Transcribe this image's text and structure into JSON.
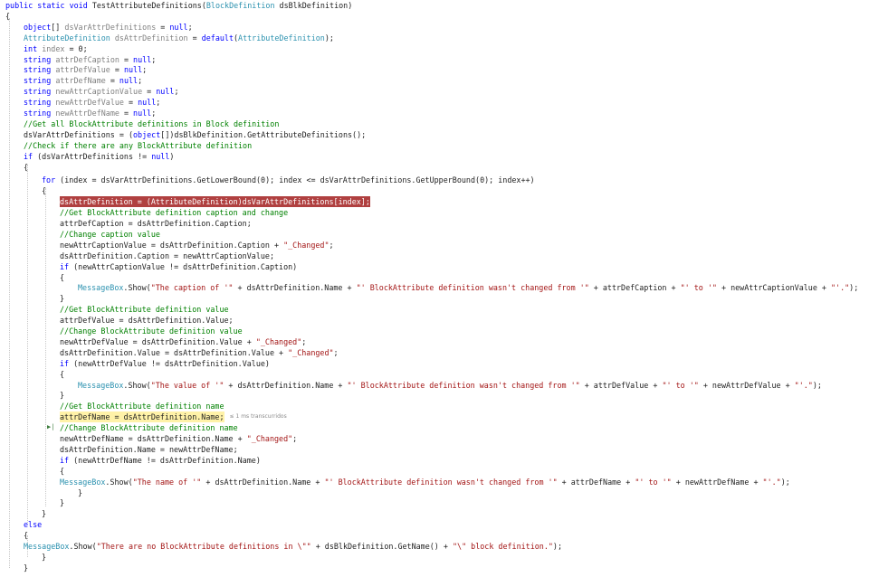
{
  "code": {
    "lines": [
      [
        {
          "t": "public static void ",
          "c": "kw"
        },
        {
          "t": "TestAttributeDefinitions(",
          "c": ""
        },
        {
          "t": "BlockDefinition",
          "c": "ty"
        },
        {
          "t": " dsBlkDefinition)",
          "c": ""
        }
      ],
      [
        {
          "t": "{",
          "c": ""
        }
      ],
      [
        {
          "t": "object",
          "c": "kw"
        },
        {
          "t": "[] ",
          "c": ""
        },
        {
          "t": "dsVarAttrDefinitions",
          "c": "dim"
        },
        {
          "t": " = ",
          "c": ""
        },
        {
          "t": "null",
          "c": "kw"
        },
        {
          "t": ";",
          "c": ""
        }
      ],
      [
        {
          "t": "AttributeDefinition",
          "c": "ty"
        },
        {
          "t": " ",
          "c": ""
        },
        {
          "t": "dsAttrDefinition",
          "c": "dim"
        },
        {
          "t": " = ",
          "c": ""
        },
        {
          "t": "default",
          "c": "kw"
        },
        {
          "t": "(",
          "c": ""
        },
        {
          "t": "AttributeDefinition",
          "c": "ty"
        },
        {
          "t": ");",
          "c": ""
        }
      ],
      [
        {
          "t": "int",
          "c": "kw"
        },
        {
          "t": " ",
          "c": ""
        },
        {
          "t": "index",
          "c": "dim"
        },
        {
          "t": " = 0;",
          "c": ""
        }
      ],
      [
        {
          "t": "string",
          "c": "kw"
        },
        {
          "t": " ",
          "c": ""
        },
        {
          "t": "attrDefCaption",
          "c": "dim"
        },
        {
          "t": " = ",
          "c": ""
        },
        {
          "t": "null",
          "c": "kw"
        },
        {
          "t": ";",
          "c": ""
        }
      ],
      [
        {
          "t": "string",
          "c": "kw"
        },
        {
          "t": " ",
          "c": ""
        },
        {
          "t": "attrDefValue",
          "c": "dim"
        },
        {
          "t": " = ",
          "c": ""
        },
        {
          "t": "null",
          "c": "kw"
        },
        {
          "t": ";",
          "c": ""
        }
      ],
      [
        {
          "t": "string",
          "c": "kw"
        },
        {
          "t": " ",
          "c": ""
        },
        {
          "t": "attrDefName",
          "c": "dim"
        },
        {
          "t": " = ",
          "c": ""
        },
        {
          "t": "null",
          "c": "kw"
        },
        {
          "t": ";",
          "c": ""
        }
      ],
      [
        {
          "t": "string",
          "c": "kw"
        },
        {
          "t": " ",
          "c": ""
        },
        {
          "t": "newAttrCaptionValue",
          "c": "dim"
        },
        {
          "t": " = ",
          "c": ""
        },
        {
          "t": "null",
          "c": "kw"
        },
        {
          "t": ";",
          "c": ""
        }
      ],
      [
        {
          "t": "string",
          "c": "kw"
        },
        {
          "t": " ",
          "c": ""
        },
        {
          "t": "newAttrDefValue",
          "c": "dim"
        },
        {
          "t": " = ",
          "c": ""
        },
        {
          "t": "null",
          "c": "kw"
        },
        {
          "t": ";",
          "c": ""
        }
      ],
      [
        {
          "t": "string",
          "c": "kw"
        },
        {
          "t": " ",
          "c": ""
        },
        {
          "t": "newAttrDefName",
          "c": "dim"
        },
        {
          "t": " = ",
          "c": ""
        },
        {
          "t": "null",
          "c": "kw"
        },
        {
          "t": ";",
          "c": ""
        }
      ],
      [
        {
          "t": "//Get all BlockAttribute definitions in Block definition",
          "c": "cm"
        }
      ],
      [
        {
          "t": "dsVarAttrDefinitions = (",
          "c": ""
        },
        {
          "t": "object",
          "c": "kw"
        },
        {
          "t": "[])dsBlkDefinition.GetAttributeDefinitions();",
          "c": ""
        }
      ],
      [
        {
          "t": "//Check if there are any BlockAttribute definition",
          "c": "cm"
        }
      ],
      [
        {
          "t": "if",
          "c": "kw"
        },
        {
          "t": " (dsVarAttrDefinitions != ",
          "c": ""
        },
        {
          "t": "null",
          "c": "kw"
        },
        {
          "t": ")",
          "c": ""
        }
      ],
      [
        {
          "t": "{",
          "c": ""
        }
      ],
      [
        {
          "t": "for",
          "c": "kw"
        },
        {
          "t": " (index = dsVarAttrDefinitions.GetLowerBound(0); index <= dsVarAttrDefinitions.GetUpperBound(0); index++)",
          "c": ""
        }
      ],
      [
        {
          "t": "{",
          "c": ""
        }
      ],
      [
        {
          "t": "dsAttrDefinition = (AttributeDefinition)dsVarAttrDefinitions[index];",
          "c": "err-hl"
        }
      ],
      [
        {
          "t": "//Get BlockAttribute definition caption and change",
          "c": "cm"
        }
      ],
      [
        {
          "t": "attrDefCaption = dsAttrDefinition.Caption;",
          "c": ""
        }
      ],
      [
        {
          "t": "//Change caption value",
          "c": "cm"
        }
      ],
      [
        {
          "t": "newAttrCaptionValue = dsAttrDefinition.Caption + ",
          "c": ""
        },
        {
          "t": "\"_Changed\"",
          "c": "st"
        },
        {
          "t": ";",
          "c": ""
        }
      ],
      [
        {
          "t": "dsAttrDefinition.Caption = newAttrCaptionValue;",
          "c": ""
        }
      ],
      [
        {
          "t": "if",
          "c": "kw"
        },
        {
          "t": " (newAttrCaptionValue != dsAttrDefinition.Caption)",
          "c": ""
        }
      ],
      [
        {
          "t": "{",
          "c": ""
        }
      ],
      [
        {
          "t": "MessageBox",
          "c": "ty"
        },
        {
          "t": ".Show(",
          "c": ""
        },
        {
          "t": "\"The caption of '\"",
          "c": "st"
        },
        {
          "t": " + dsAttrDefinition.Name + ",
          "c": ""
        },
        {
          "t": "\"' BlockAttribute definition wasn't changed from '\"",
          "c": "st"
        },
        {
          "t": " + attrDefCaption + ",
          "c": ""
        },
        {
          "t": "\"' to '\"",
          "c": "st"
        },
        {
          "t": " + newAttrCaptionValue + ",
          "c": ""
        },
        {
          "t": "\"'.\"",
          "c": "st"
        },
        {
          "t": ");",
          "c": ""
        }
      ],
      [
        {
          "t": "}",
          "c": ""
        }
      ],
      [
        {
          "t": "//Get BlockAttribute definition value",
          "c": "cm"
        }
      ],
      [
        {
          "t": "attrDefValue = dsAttrDefinition.Value;",
          "c": ""
        }
      ],
      [
        {
          "t": "//Change BlockAttribute definition value",
          "c": "cm"
        }
      ],
      [
        {
          "t": "newAttrDefValue = dsAttrDefinition.Value + ",
          "c": ""
        },
        {
          "t": "\"_Changed\"",
          "c": "st"
        },
        {
          "t": ";",
          "c": ""
        }
      ],
      [
        {
          "t": "dsAttrDefinition.Value = dsAttrDefinition.Value + ",
          "c": ""
        },
        {
          "t": "\"_Changed\"",
          "c": "st"
        },
        {
          "t": ";",
          "c": ""
        }
      ],
      [
        {
          "t": "if",
          "c": "kw"
        },
        {
          "t": " (newAttrDefValue != dsAttrDefinition.Value)",
          "c": ""
        }
      ],
      [
        {
          "t": "{",
          "c": ""
        }
      ],
      [
        {
          "t": "MessageBox",
          "c": "ty"
        },
        {
          "t": ".Show(",
          "c": ""
        },
        {
          "t": "\"The value of '\"",
          "c": "st"
        },
        {
          "t": " + dsAttrDefinition.Name + ",
          "c": ""
        },
        {
          "t": "\"' BlockAttribute definition wasn't changed from '\"",
          "c": "st"
        },
        {
          "t": " + attrDefValue + ",
          "c": ""
        },
        {
          "t": "\"' to '\"",
          "c": "st"
        },
        {
          "t": " + newAttrDefValue + ",
          "c": ""
        },
        {
          "t": "\"'.\"",
          "c": "st"
        },
        {
          "t": ");",
          "c": ""
        }
      ],
      [
        {
          "t": "}",
          "c": ""
        }
      ],
      [
        {
          "t": "//Get BlockAttribute definition name",
          "c": "cm"
        }
      ],
      [
        {
          "t": "attrDefName = dsAttrDefinition.Name;",
          "c": "cur-hl"
        }
      ],
      [
        {
          "t": "//Change BlockAttribute definition name",
          "c": "cm"
        }
      ],
      [
        {
          "t": "newAttrDefName = dsAttrDefinition.Name + ",
          "c": ""
        },
        {
          "t": "\"_Changed\"",
          "c": "st"
        },
        {
          "t": ";",
          "c": ""
        }
      ],
      [
        {
          "t": "dsAttrDefinition.Name = newAttrDefName;",
          "c": ""
        }
      ],
      [
        {
          "t": "if",
          "c": "kw"
        },
        {
          "t": " (newAttrDefName != dsAttrDefinition.Name)",
          "c": ""
        }
      ],
      [
        {
          "t": "{",
          "c": ""
        }
      ],
      [
        {
          "t": "MessageBox",
          "c": "ty"
        },
        {
          "t": ".Show(",
          "c": ""
        },
        {
          "t": "\"The name of '\"",
          "c": "st"
        },
        {
          "t": " + dsAttrDefinition.Name + ",
          "c": ""
        },
        {
          "t": "\"' BlockAttribute definition wasn't changed from '\"",
          "c": "st"
        },
        {
          "t": " + attrDefName + ",
          "c": ""
        },
        {
          "t": "\"' to '\"",
          "c": "st"
        },
        {
          "t": " + newAttrDefName + ",
          "c": ""
        },
        {
          "t": "\"'.\"",
          "c": "st"
        },
        {
          "t": ");",
          "c": ""
        }
      ],
      [
        {
          "t": "}",
          "c": ""
        }
      ],
      [
        {
          "t": "}",
          "c": ""
        }
      ],
      [
        {
          "t": "}",
          "c": ""
        }
      ],
      [
        {
          "t": "else",
          "c": "kw"
        }
      ],
      [
        {
          "t": "{",
          "c": ""
        }
      ],
      [
        {
          "t": "MessageBox",
          "c": "ty"
        },
        {
          "t": ".Show(",
          "c": ""
        },
        {
          "t": "\"There are no BlockAttribute definitions in \\\"\"",
          "c": "st"
        },
        {
          "t": " + dsBlkDefinition.GetName() + ",
          "c": ""
        },
        {
          "t": "\"\\\" block definition.\"",
          "c": "st"
        },
        {
          "t": ");",
          "c": ""
        }
      ],
      [
        {
          "t": "}",
          "c": ""
        }
      ],
      [
        {
          "t": "}",
          "c": ""
        }
      ]
    ],
    "perf_tip": "≤ 1 ms transcurridos",
    "colors": {
      "keyword": "#0000ff",
      "type": "#2b91af",
      "comment": "#008000",
      "string": "#a31515",
      "error_highlight": "#b04040",
      "current_line": "#fff2a8"
    }
  }
}
